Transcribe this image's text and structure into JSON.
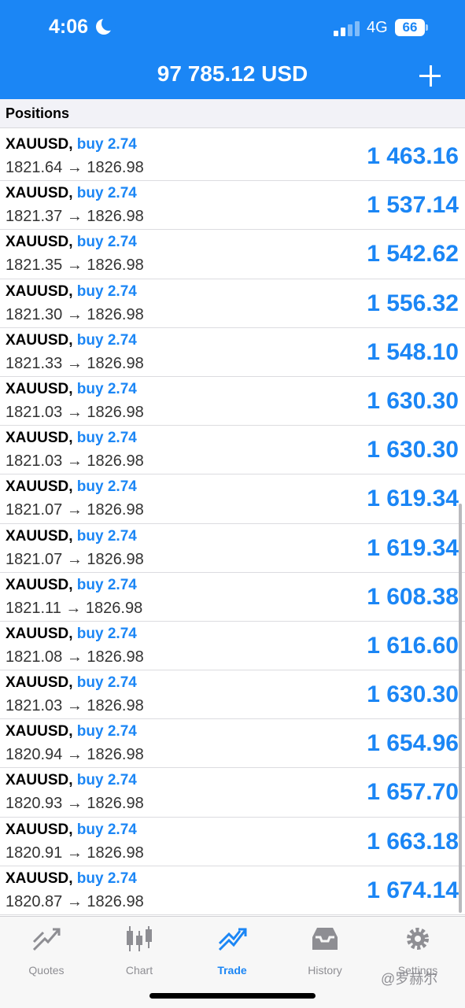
{
  "status_bar": {
    "time": "4:06",
    "network": "4G",
    "battery": "66"
  },
  "header": {
    "balance": "97 785.12 USD"
  },
  "section": {
    "title": "Positions"
  },
  "positions": [
    {
      "symbol": "XAUUSD,",
      "direction": "buy 2.74",
      "route": "1821.64 → 1826.98",
      "profit": "1 463.16"
    },
    {
      "symbol": "XAUUSD,",
      "direction": "buy 2.74",
      "route": "1821.37 → 1826.98",
      "profit": "1 537.14"
    },
    {
      "symbol": "XAUUSD,",
      "direction": "buy 2.74",
      "route": "1821.35 → 1826.98",
      "profit": "1 542.62"
    },
    {
      "symbol": "XAUUSD,",
      "direction": "buy 2.74",
      "route": "1821.30 → 1826.98",
      "profit": "1 556.32"
    },
    {
      "symbol": "XAUUSD,",
      "direction": "buy 2.74",
      "route": "1821.33 → 1826.98",
      "profit": "1 548.10"
    },
    {
      "symbol": "XAUUSD,",
      "direction": "buy 2.74",
      "route": "1821.03 → 1826.98",
      "profit": "1 630.30"
    },
    {
      "symbol": "XAUUSD,",
      "direction": "buy 2.74",
      "route": "1821.03 → 1826.98",
      "profit": "1 630.30"
    },
    {
      "symbol": "XAUUSD,",
      "direction": "buy 2.74",
      "route": "1821.07 → 1826.98",
      "profit": "1 619.34"
    },
    {
      "symbol": "XAUUSD,",
      "direction": "buy 2.74",
      "route": "1821.07 → 1826.98",
      "profit": "1 619.34"
    },
    {
      "symbol": "XAUUSD,",
      "direction": "buy 2.74",
      "route": "1821.11 → 1826.98",
      "profit": "1 608.38"
    },
    {
      "symbol": "XAUUSD,",
      "direction": "buy 2.74",
      "route": "1821.08 → 1826.98",
      "profit": "1 616.60"
    },
    {
      "symbol": "XAUUSD,",
      "direction": "buy 2.74",
      "route": "1821.03 → 1826.98",
      "profit": "1 630.30"
    },
    {
      "symbol": "XAUUSD,",
      "direction": "buy 2.74",
      "route": "1820.94 → 1826.98",
      "profit": "1 654.96"
    },
    {
      "symbol": "XAUUSD,",
      "direction": "buy 2.74",
      "route": "1820.93 → 1826.98",
      "profit": "1 657.70"
    },
    {
      "symbol": "XAUUSD,",
      "direction": "buy 2.74",
      "route": "1820.91 → 1826.98",
      "profit": "1 663.18"
    },
    {
      "symbol": "XAUUSD,",
      "direction": "buy 2.74",
      "route": "1820.87 → 1826.98",
      "profit": "1 674.14"
    }
  ],
  "tabs": [
    {
      "label": "Quotes",
      "icon": "quotes-icon",
      "active": false
    },
    {
      "label": "Chart",
      "icon": "candlestick-chart-icon",
      "active": false
    },
    {
      "label": "Trade",
      "icon": "trade-icon",
      "active": true
    },
    {
      "label": "History",
      "icon": "history-icon",
      "active": false
    },
    {
      "label": "Settings",
      "icon": "gear-icon",
      "active": false
    }
  ],
  "watermark": "@罗赫尔",
  "colors": {
    "accent": "#1b86f5",
    "inactive": "#8e8e93"
  }
}
